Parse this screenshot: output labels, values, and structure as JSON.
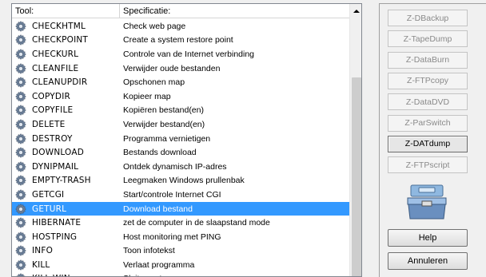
{
  "list": {
    "headers": {
      "tool": "Tool:",
      "spec": "Specificatie:"
    },
    "rows": [
      {
        "tool": "CHECKHTML",
        "spec": "Check web page",
        "selected": false
      },
      {
        "tool": "CHECKPOINT",
        "spec": "Create a system restore point",
        "selected": false
      },
      {
        "tool": "CHECKURL",
        "spec": "Controle van de Internet verbinding",
        "selected": false
      },
      {
        "tool": "CLEANFILE",
        "spec": "Verwijder oude bestanden",
        "selected": false
      },
      {
        "tool": "CLEANUPDIR",
        "spec": "Opschonen map",
        "selected": false
      },
      {
        "tool": "COPYDIR",
        "spec": "Kopieer map",
        "selected": false
      },
      {
        "tool": "COPYFILE",
        "spec": "Kopiëren bestand(en)",
        "selected": false
      },
      {
        "tool": "DELETE",
        "spec": "Verwijder bestand(en)",
        "selected": false
      },
      {
        "tool": "DESTROY",
        "spec": "Programma vernietigen",
        "selected": false
      },
      {
        "tool": "DOWNLOAD",
        "spec": "Bestands download",
        "selected": false
      },
      {
        "tool": "DYNIPMAIL",
        "spec": "Ontdek dynamisch IP-adres",
        "selected": false
      },
      {
        "tool": "EMPTY-TRASH",
        "spec": "Leegmaken Windows prullenbak",
        "selected": false
      },
      {
        "tool": "GETCGI",
        "spec": "Start/controle Internet CGI",
        "selected": false
      },
      {
        "tool": "GETURL",
        "spec": "Download bestand",
        "selected": true
      },
      {
        "tool": "HIBERNATE",
        "spec": "zet de computer in de slaapstand mode",
        "selected": false
      },
      {
        "tool": "HOSTPING",
        "spec": "Host monitoring met PING",
        "selected": false
      },
      {
        "tool": "INFO",
        "spec": "Toon infotekst",
        "selected": false
      },
      {
        "tool": "KILL",
        "spec": "Verlaat programma",
        "selected": false
      },
      {
        "tool": "KILL-WIN",
        "spec": "Sluit venster",
        "selected": false
      }
    ]
  },
  "side": {
    "zbuttons": [
      {
        "label": "Z-DBackup",
        "state": "disabled"
      },
      {
        "label": "Z-TapeDump",
        "state": "disabled"
      },
      {
        "label": "Z-DataBurn",
        "state": "disabled"
      },
      {
        "label": "Z-FTPcopy",
        "state": "disabled"
      },
      {
        "label": "Z-DataDVD",
        "state": "disabled"
      },
      {
        "label": "Z-ParSwitch",
        "state": "disabled"
      },
      {
        "label": "Z-DATdump",
        "state": "pressed"
      },
      {
        "label": "Z-FTPscript",
        "state": "disabled"
      }
    ],
    "help_label": "Help",
    "cancel_label": "Annuleren"
  },
  "colors": {
    "selection": "#3399ff",
    "panel_bg": "#f0f0f0"
  },
  "icons": {
    "row_icon": "gear-icon",
    "toolbox_icon": "toolbox-icon",
    "scroll_up": "scroll-up-arrow-icon"
  }
}
